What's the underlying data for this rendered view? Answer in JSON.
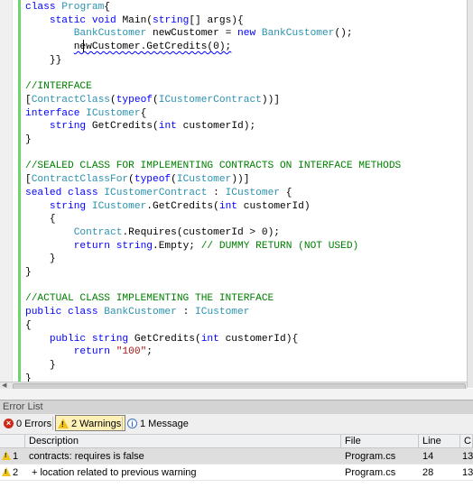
{
  "editor": {
    "lines": [
      {
        "segments": [
          {
            "t": "kw",
            "s": "class "
          },
          {
            "t": "ty",
            "s": "Program"
          },
          {
            "t": "tx",
            "s": "{"
          }
        ]
      },
      {
        "segments": [
          {
            "t": "tx",
            "s": "    "
          },
          {
            "t": "kw",
            "s": "static void "
          },
          {
            "t": "tx",
            "s": "Main("
          },
          {
            "t": "kw",
            "s": "string"
          },
          {
            "t": "tx",
            "s": "[] args){"
          }
        ]
      },
      {
        "segments": [
          {
            "t": "tx",
            "s": "        "
          },
          {
            "t": "ty",
            "s": "BankCustomer"
          },
          {
            "t": "tx",
            "s": " newCustomer = "
          },
          {
            "t": "kw",
            "s": "new "
          },
          {
            "t": "ty",
            "s": "BankCustomer"
          },
          {
            "t": "tx",
            "s": "();"
          }
        ]
      },
      {
        "segments": [
          {
            "t": "tx",
            "s": "        "
          },
          {
            "t": "tx",
            "s": "newCustomer.GetCredits(0);",
            "squiggle": true
          }
        ]
      },
      {
        "segments": [
          {
            "t": "tx",
            "s": "    }}"
          }
        ]
      },
      {
        "segments": []
      },
      {
        "segments": [
          {
            "t": "cm",
            "s": "//INTERFACE"
          }
        ]
      },
      {
        "segments": [
          {
            "t": "tx",
            "s": "["
          },
          {
            "t": "ty",
            "s": "ContractClass"
          },
          {
            "t": "tx",
            "s": "("
          },
          {
            "t": "kw",
            "s": "typeof"
          },
          {
            "t": "tx",
            "s": "("
          },
          {
            "t": "ty",
            "s": "ICustomerContract"
          },
          {
            "t": "tx",
            "s": "))]"
          }
        ]
      },
      {
        "segments": [
          {
            "t": "kw",
            "s": "interface "
          },
          {
            "t": "ty",
            "s": "ICustomer"
          },
          {
            "t": "tx",
            "s": "{"
          }
        ]
      },
      {
        "segments": [
          {
            "t": "tx",
            "s": "    "
          },
          {
            "t": "kw",
            "s": "string"
          },
          {
            "t": "tx",
            "s": " GetCredits("
          },
          {
            "t": "kw",
            "s": "int"
          },
          {
            "t": "tx",
            "s": " customerId);"
          }
        ]
      },
      {
        "segments": [
          {
            "t": "tx",
            "s": "}"
          }
        ]
      },
      {
        "segments": []
      },
      {
        "segments": [
          {
            "t": "cm",
            "s": "//SEALED CLASS FOR IMPLEMENTING CONTRACTS ON INTERFACE METHODS"
          }
        ]
      },
      {
        "segments": [
          {
            "t": "tx",
            "s": "["
          },
          {
            "t": "ty",
            "s": "ContractClassFor"
          },
          {
            "t": "tx",
            "s": "("
          },
          {
            "t": "kw",
            "s": "typeof"
          },
          {
            "t": "tx",
            "s": "("
          },
          {
            "t": "ty",
            "s": "ICustomer"
          },
          {
            "t": "tx",
            "s": "))]"
          }
        ]
      },
      {
        "segments": [
          {
            "t": "kw",
            "s": "sealed class "
          },
          {
            "t": "ty",
            "s": "ICustomerContract"
          },
          {
            "t": "tx",
            "s": " : "
          },
          {
            "t": "ty",
            "s": "ICustomer"
          },
          {
            "t": "tx",
            "s": " {"
          }
        ]
      },
      {
        "segments": [
          {
            "t": "tx",
            "s": "    "
          },
          {
            "t": "kw",
            "s": "string "
          },
          {
            "t": "ty",
            "s": "ICustomer"
          },
          {
            "t": "tx",
            "s": ".GetCredits("
          },
          {
            "t": "kw",
            "s": "int"
          },
          {
            "t": "tx",
            "s": " customerId)"
          }
        ]
      },
      {
        "segments": [
          {
            "t": "tx",
            "s": "    {"
          }
        ]
      },
      {
        "segments": [
          {
            "t": "tx",
            "s": "        "
          },
          {
            "t": "ty",
            "s": "Contract"
          },
          {
            "t": "tx",
            "s": ".Requires(customerId > 0);"
          }
        ]
      },
      {
        "segments": [
          {
            "t": "tx",
            "s": "        "
          },
          {
            "t": "kw",
            "s": "return string"
          },
          {
            "t": "tx",
            "s": ".Empty; "
          },
          {
            "t": "cm",
            "s": "// DUMMY RETURN (NOT USED)"
          }
        ]
      },
      {
        "segments": [
          {
            "t": "tx",
            "s": "    }"
          }
        ]
      },
      {
        "segments": [
          {
            "t": "tx",
            "s": "}"
          }
        ]
      },
      {
        "segments": []
      },
      {
        "segments": [
          {
            "t": "cm",
            "s": "//ACTUAL CLASS IMPLEMENTING THE INTERFACE"
          }
        ]
      },
      {
        "segments": [
          {
            "t": "kw",
            "s": "public class "
          },
          {
            "t": "ty",
            "s": "BankCustomer"
          },
          {
            "t": "tx",
            "s": " : "
          },
          {
            "t": "ty",
            "s": "ICustomer"
          }
        ]
      },
      {
        "segments": [
          {
            "t": "tx",
            "s": "{"
          }
        ]
      },
      {
        "segments": [
          {
            "t": "tx",
            "s": "    "
          },
          {
            "t": "kw",
            "s": "public string"
          },
          {
            "t": "tx",
            "s": " GetCredits("
          },
          {
            "t": "kw",
            "s": "int"
          },
          {
            "t": "tx",
            "s": " customerId){"
          }
        ]
      },
      {
        "segments": [
          {
            "t": "tx",
            "s": "        "
          },
          {
            "t": "kw",
            "s": "return "
          },
          {
            "t": "st",
            "s": "\"100\""
          },
          {
            "t": "tx",
            "s": ";"
          }
        ]
      },
      {
        "segments": [
          {
            "t": "tx",
            "s": "    }"
          }
        ]
      },
      {
        "segments": [
          {
            "t": "tx",
            "s": "}"
          }
        ]
      }
    ]
  },
  "error_list": {
    "title": "Error List",
    "filters": {
      "errors": "0 Errors",
      "warnings": "2 Warnings",
      "messages": "1 Message"
    },
    "columns": [
      "Description",
      "File",
      "Line",
      "C"
    ],
    "rows": [
      {
        "num": "1",
        "description": "contracts: requires is false",
        "file": "Program.cs",
        "line": "14",
        "column": "13"
      },
      {
        "num": "2",
        "description": "+ location related to previous warning",
        "file": "Program.cs",
        "line": "28",
        "column": "13"
      }
    ]
  },
  "colors": {
    "keyword": "#0000ff",
    "type": "#2b91af",
    "comment": "#008000",
    "string": "#a31515",
    "warning": "#f0c419",
    "error": "#cc2a1a"
  }
}
